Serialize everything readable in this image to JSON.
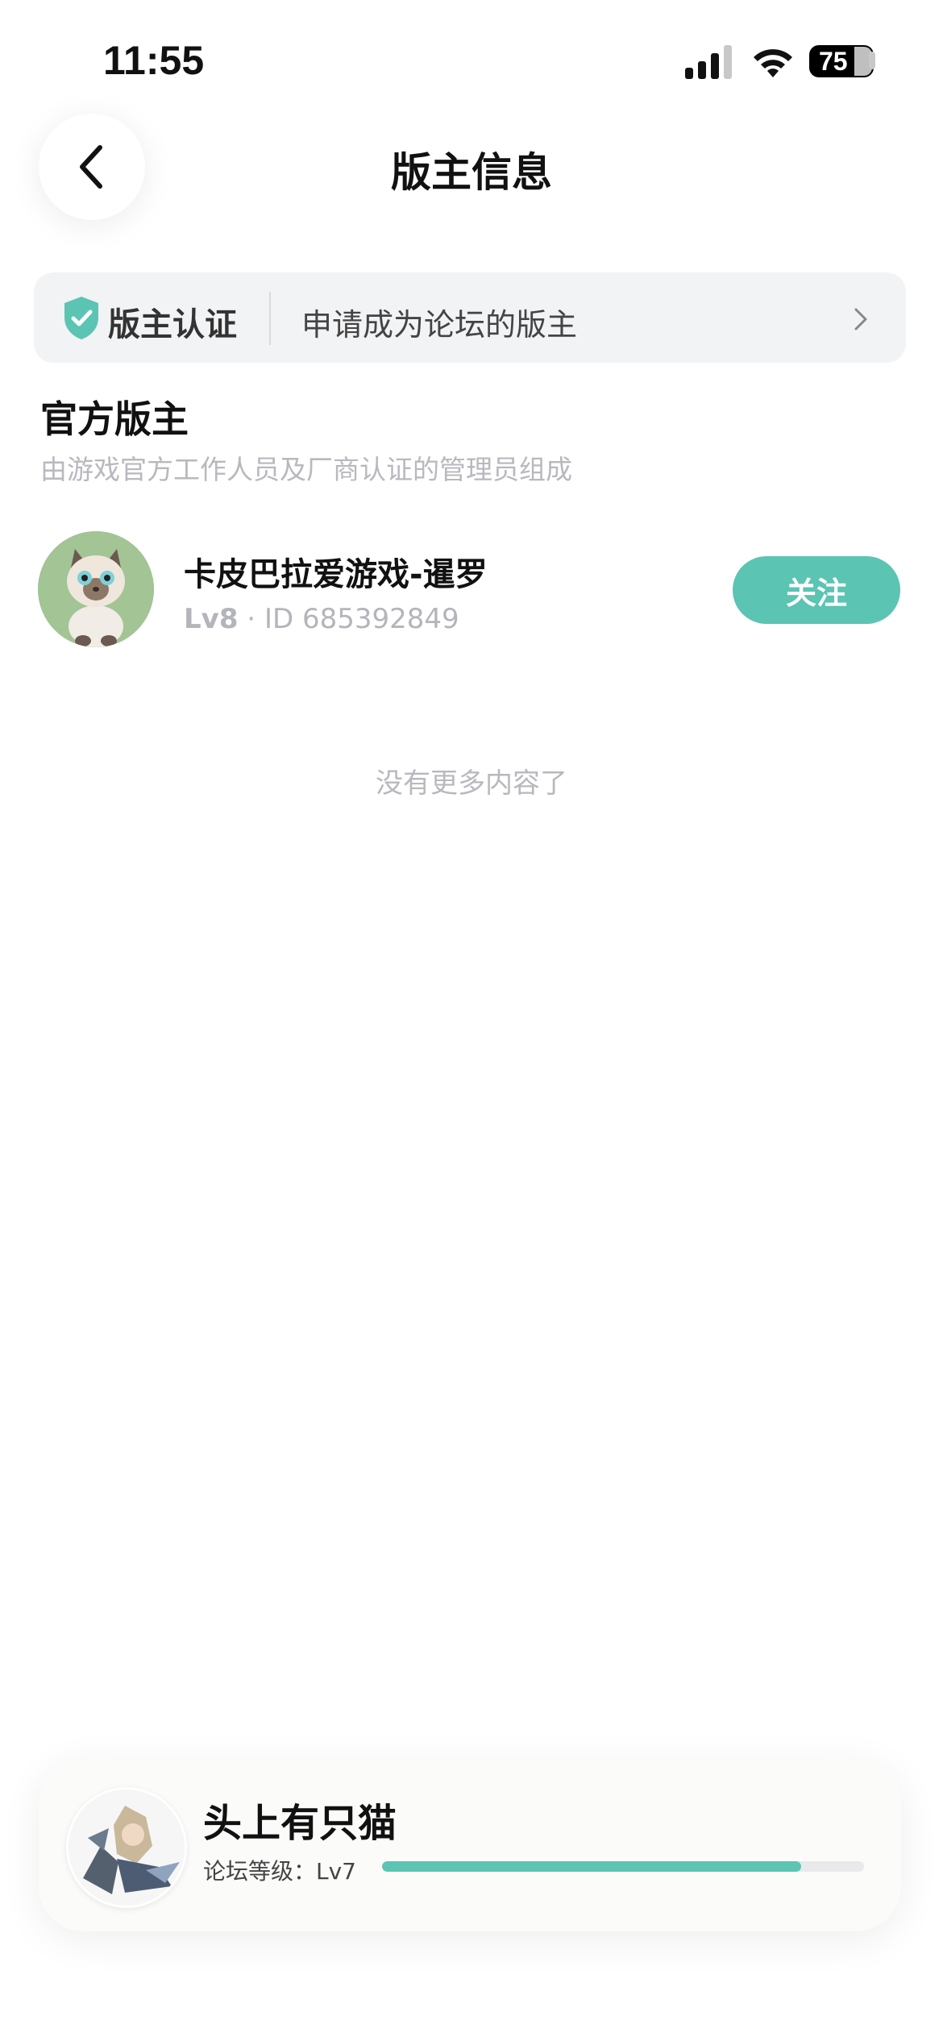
{
  "status_bar": {
    "time": "11:55",
    "battery": "75"
  },
  "header": {
    "title": "版主信息"
  },
  "cert_bar": {
    "label": "版主认证",
    "text": "申请成为论坛的版主"
  },
  "section": {
    "title": "官方版主",
    "subtitle": "由游戏官方工作人员及厂商认证的管理员组成"
  },
  "moderators": [
    {
      "name": "卡皮巴拉爱游戏-暹罗",
      "level": "Lv8",
      "separator": " · ",
      "id_text": "ID 685392849",
      "follow_label": "关注"
    }
  ],
  "footer_note": "没有更多内容了",
  "user_card": {
    "name": "头上有只猫",
    "level_label": "论坛等级：Lv7",
    "progress": 0.87
  },
  "colors": {
    "accent": "#5bc4b3",
    "muted": "#b8b8be",
    "bar_bg": "#f2f3f5"
  }
}
